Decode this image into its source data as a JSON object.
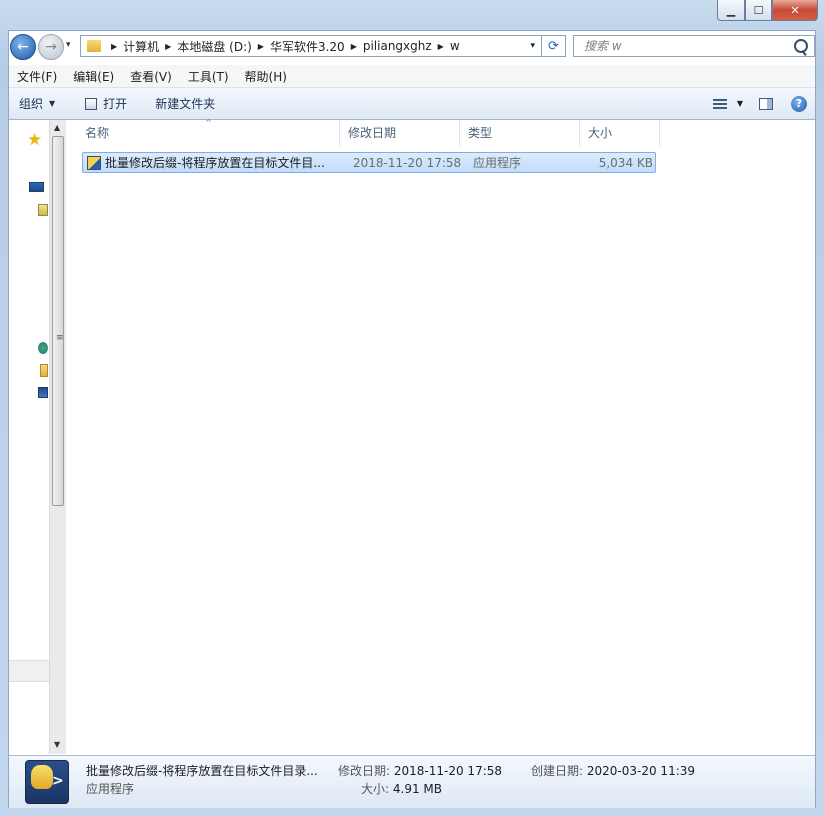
{
  "window": {
    "caption_buttons": {
      "minimize": "▁",
      "maximize": "☐",
      "close": "✕"
    }
  },
  "address": {
    "crumbs": [
      "计算机",
      "本地磁盘 (D:)",
      "华军软件3.20",
      "piliangxghz",
      "w"
    ],
    "separator": "▶",
    "dropdown": "▾",
    "refresh": "⟳"
  },
  "search": {
    "placeholder": "搜索 w"
  },
  "menu": [
    "文件(F)",
    "编辑(E)",
    "查看(V)",
    "工具(T)",
    "帮助(H)"
  ],
  "commands": {
    "organize": "组织",
    "dropdown_arrow": "▼",
    "open": "打开",
    "new_folder": "新建文件夹",
    "help": "?"
  },
  "columns": {
    "name": "名称",
    "date": "修改日期",
    "type": "类型",
    "size": "大小",
    "sort_caret": "^"
  },
  "files": [
    {
      "name": "批量修改后缀-将程序放置在目标文件目...",
      "date": "2018-11-20 17:58",
      "type": "应用程序",
      "size": "5,034 KB",
      "selected": true
    }
  ],
  "details": {
    "name": "批量修改后缀-将程序放置在目标文件目录...",
    "type": "应用程序",
    "modified_label": "修改日期:",
    "modified": "2018-11-20 17:58",
    "created_label": "创建日期:",
    "created": "2020-03-20 11:39",
    "size_label": "大小:",
    "size": "4.91 MB"
  },
  "scroll": {
    "up": "▲",
    "down": "▼",
    "grip": "≡"
  },
  "nav_icons": [
    "favorites-star-icon",
    "desktop-icon",
    "libraries-icon",
    "network-icon",
    "folder-icon",
    "computer-icon"
  ],
  "colors": {
    "selection": "#c1dcfb",
    "selection_border": "#84acdd",
    "chrome": "#c9dcee",
    "close_button": "#c74a36"
  }
}
